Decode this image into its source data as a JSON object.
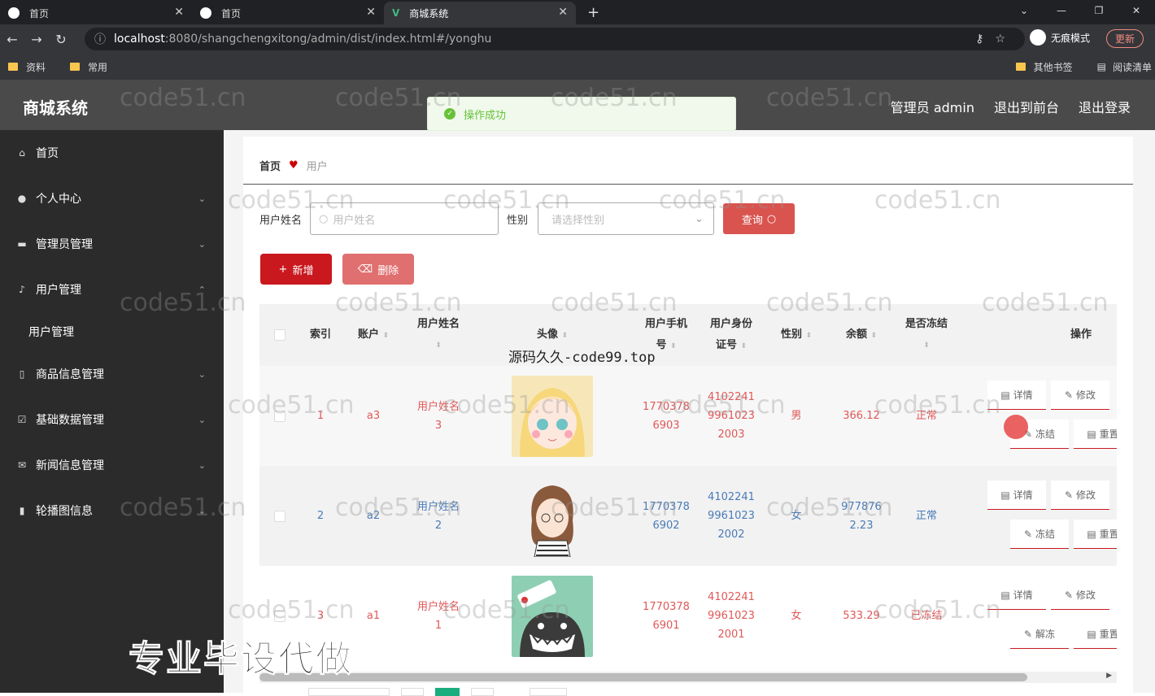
{
  "browser": {
    "tabs": [
      {
        "label": "首页",
        "active": false
      },
      {
        "label": "首页",
        "active": false
      },
      {
        "label": "商城系统",
        "active": true
      }
    ],
    "url_host": "localhost",
    "url_rest": ":8080/shangchengxitong/admin/dist/index.html#/yonghu",
    "incognito": "无痕模式",
    "update": "更新",
    "bookmarks_left": [
      "资料",
      "常用"
    ],
    "bookmarks_right": [
      "其他书签",
      "阅读清单"
    ]
  },
  "header": {
    "title": "商城系统",
    "user": "管理员 admin",
    "back_front": "退出到前台",
    "logout": "退出登录"
  },
  "toast": {
    "text": "操作成功"
  },
  "sidebar": {
    "items": [
      {
        "label": "首页",
        "icon": "home-icon"
      },
      {
        "label": "个人中心",
        "icon": "user-icon"
      },
      {
        "label": "管理员管理",
        "icon": "chat-icon"
      },
      {
        "label": "用户管理",
        "icon": "mic-icon"
      },
      {
        "label": "用户管理",
        "sub": true
      },
      {
        "label": "商品信息管理",
        "icon": "phone-icon"
      },
      {
        "label": "基础数据管理",
        "icon": "check-icon"
      },
      {
        "label": "新闻信息管理",
        "icon": "mail-icon"
      },
      {
        "label": "轮播图信息",
        "icon": "chart-icon"
      }
    ]
  },
  "breadcrumb": {
    "home": "首页",
    "current": "用户"
  },
  "search": {
    "name_label": "用户姓名",
    "name_placeholder": "用户姓名",
    "gender_label": "性别",
    "gender_placeholder": "请选择性别",
    "query_button": "查询"
  },
  "actions": {
    "add": "新增",
    "delete": "删除"
  },
  "table": {
    "headers": {
      "index": "索引",
      "account": "账户",
      "name": "用户姓名",
      "avatar": "头像",
      "phone_1": "用户手机",
      "phone_2": "号",
      "idcard_1": "用户身份",
      "idcard_2": "证号",
      "gender": "性别",
      "balance": "余额",
      "frozen": "是否冻结",
      "ops": "操作"
    },
    "rows": [
      {
        "index": "1",
        "account": "a3",
        "name_1": "用户姓名",
        "name_2": "3",
        "phone_1": "1770378",
        "phone_2": "6903",
        "id_1": "4102241",
        "id_2": "9961023",
        "id_3": "2003",
        "gender": "男",
        "balance_1": "366.12",
        "balance_2": "",
        "status": "正常",
        "op1": "详情",
        "op2": "修改",
        "op3": "冻结",
        "op4": "重置"
      },
      {
        "index": "2",
        "account": "a2",
        "name_1": "用户姓名",
        "name_2": "2",
        "phone_1": "1770378",
        "phone_2": "6902",
        "id_1": "4102241",
        "id_2": "9961023",
        "id_3": "2002",
        "gender": "女",
        "balance_1": "977876",
        "balance_2": "2.23",
        "status": "正常",
        "op1": "详情",
        "op2": "修改",
        "op3": "冻结",
        "op4": "重置"
      },
      {
        "index": "3",
        "account": "a1",
        "name_1": "用户姓名",
        "name_2": "1",
        "phone_1": "1770378",
        "phone_2": "6901",
        "id_1": "4102241",
        "id_2": "9961023",
        "id_3": "2001",
        "gender": "女",
        "balance_1": "533.29",
        "balance_2": "",
        "status": "已冻结",
        "op1": "详情",
        "op2": "修改",
        "op3": "解冻",
        "op4": "重置"
      }
    ]
  },
  "overlays": {
    "watermark": "code51.cn",
    "source": "源码久久-code99.top",
    "ad": "专业毕设代做"
  },
  "colors": {
    "accent": "#c9181e",
    "sidebar": "#2b2b2b",
    "header": "#4a4a4a",
    "success": "#67c23a"
  }
}
